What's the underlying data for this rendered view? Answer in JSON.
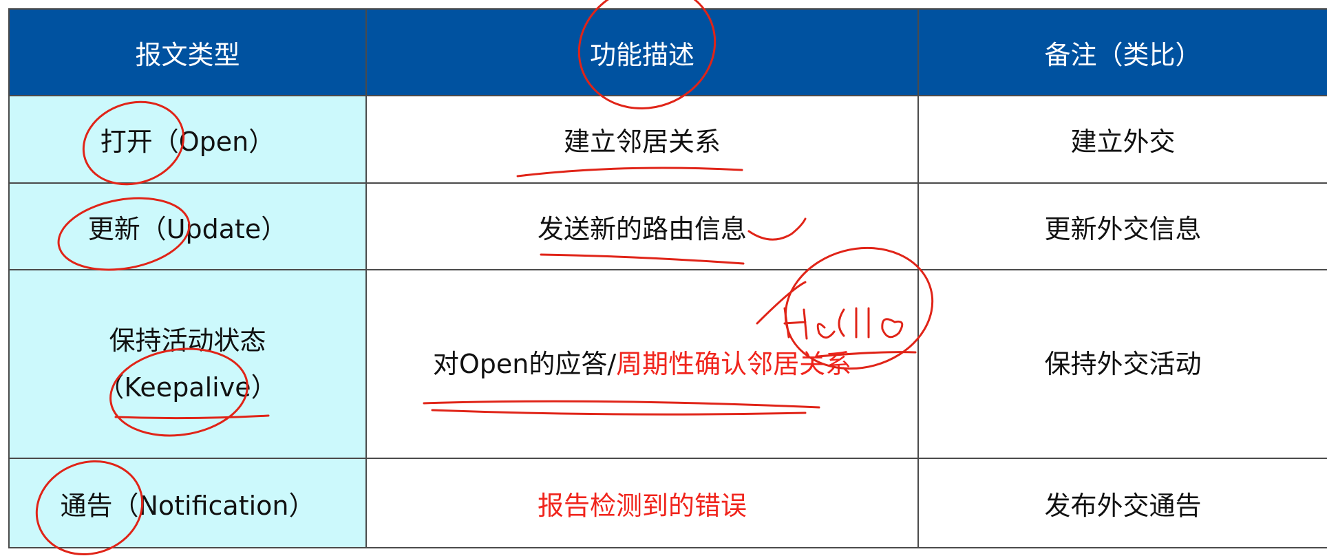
{
  "table": {
    "headers": [
      "报文类型",
      "功能描述",
      "备注（类比）"
    ],
    "rows": [
      {
        "type": "打开（Open）",
        "desc": "建立邻居关系",
        "desc_highlight": "",
        "note": "建立外交"
      },
      {
        "type": "更新（Update）",
        "desc": "发送新的路由信息",
        "desc_highlight": "",
        "note": "更新外交信息"
      },
      {
        "type_line1": "保持活动状态",
        "type_line2": "（Keepalive）",
        "desc": "对Open的应答/",
        "desc_highlight": "周期性确认邻居关系",
        "note": "保持外交活动"
      },
      {
        "type": "通告（Notification）",
        "desc": "",
        "desc_highlight": "报告检测到的错误",
        "note": "发布外交通告"
      }
    ]
  },
  "colors": {
    "header_bg": "#0052a0",
    "type_col_bg": "#ccf9fc",
    "highlight_text": "#f0241c",
    "annotation_ink": "#e02418"
  }
}
